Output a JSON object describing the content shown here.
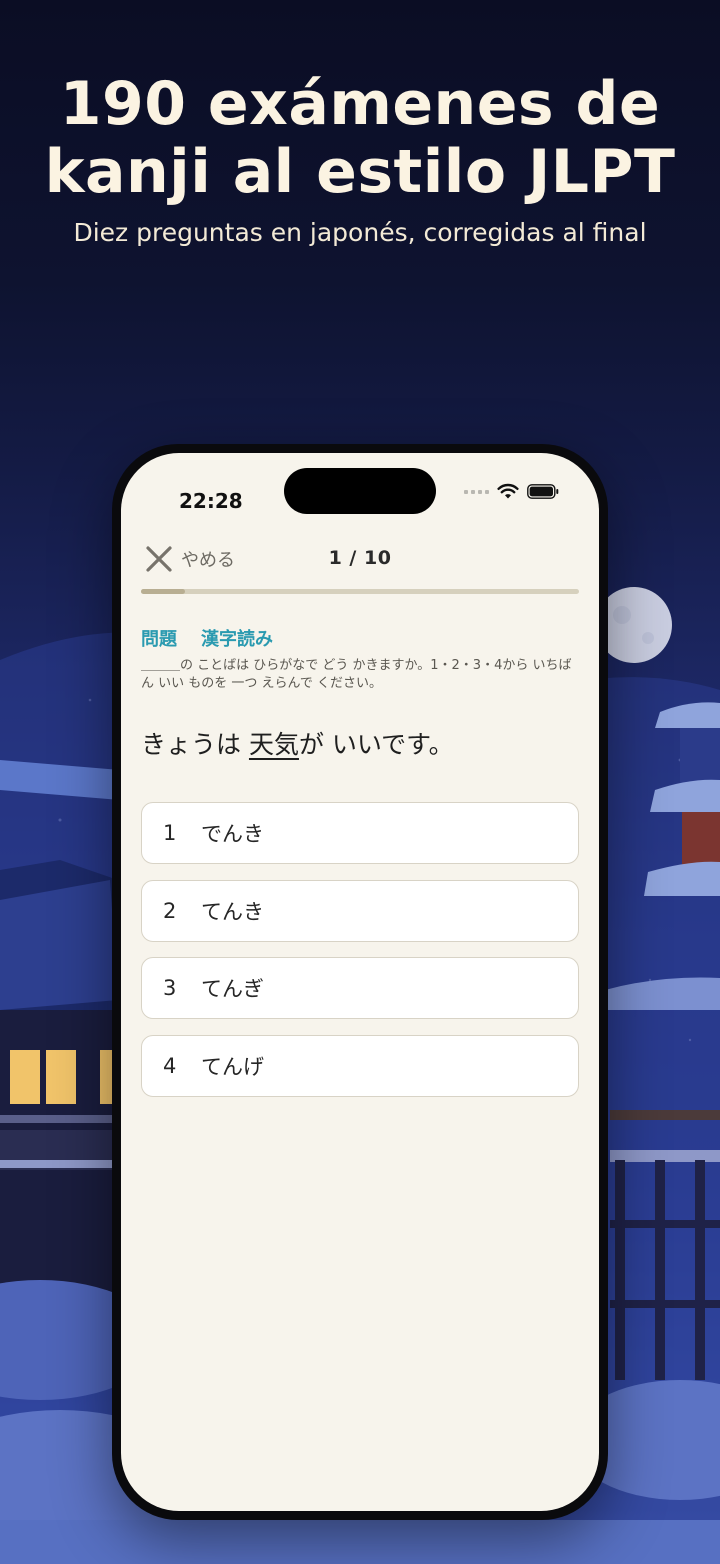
{
  "promo": {
    "title_line1": "190 exámenes de",
    "title_line2": "kanji al estilo JLPT",
    "subtitle": "Diez preguntas en japonés, corregidas al final"
  },
  "status_bar": {
    "time": "22:28"
  },
  "quiz": {
    "close_label": "やめる",
    "counter": "1 / 10",
    "progress_fraction": 0.1,
    "section_label": "問題",
    "section_type": "漢字読み",
    "instruction": "＿＿＿の ことばは ひらがなで どう かきますか。1・2・3・4から いちばん いい ものを 一つ えらんで ください。",
    "sentence_before": "きょうは ",
    "sentence_target": "天気",
    "sentence_after": "が いいです。",
    "options": [
      {
        "number": "1",
        "text": "でんき"
      },
      {
        "number": "2",
        "text": "てんき"
      },
      {
        "number": "3",
        "text": "てんぎ"
      },
      {
        "number": "4",
        "text": "てんげ"
      }
    ]
  },
  "colors": {
    "accent_teal": "#2a9ab0",
    "cream": "#f7f4ec",
    "night_sky": "#0b0d24"
  }
}
